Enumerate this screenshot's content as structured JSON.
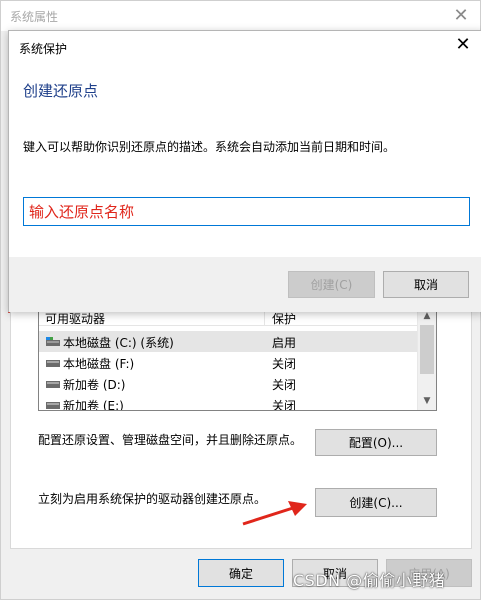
{
  "sys_props": {
    "title": "系统属性",
    "drives": {
      "header": {
        "col1": "可用驱动器",
        "col2": "保护"
      },
      "rows": [
        {
          "name": "本地磁盘 (C:) (系统)",
          "state": "启用"
        },
        {
          "name": "本地磁盘 (F:)",
          "state": "关闭"
        },
        {
          "name": "新加卷 (D:)",
          "state": "关闭"
        },
        {
          "name": "新加卷 (E:)",
          "state": "关闭"
        }
      ]
    },
    "configure_text": "配置还原设置、管理磁盘空间，并且删除还原点。",
    "configure_button": "配置(O)...",
    "create_text": "立刻为启用系统保护的驱动器创建还原点。",
    "create_button": "创建(C)...",
    "ok_button": "确定",
    "cancel_button": "取消",
    "apply_button": "应用(A)"
  },
  "dialog": {
    "title": "系统保护",
    "heading": "创建还原点",
    "description": "键入可以帮助你识别还原点的描述。系统会自动添加当前日期和时间。",
    "input_value": "输入还原点名称",
    "create_button": "创建(C)",
    "cancel_button": "取消"
  },
  "watermark": "CSDN @偷偷小野猪",
  "colors": {
    "accent": "#0078d7",
    "heading": "#1e3f8a",
    "annotation_red": "#e0261b"
  }
}
